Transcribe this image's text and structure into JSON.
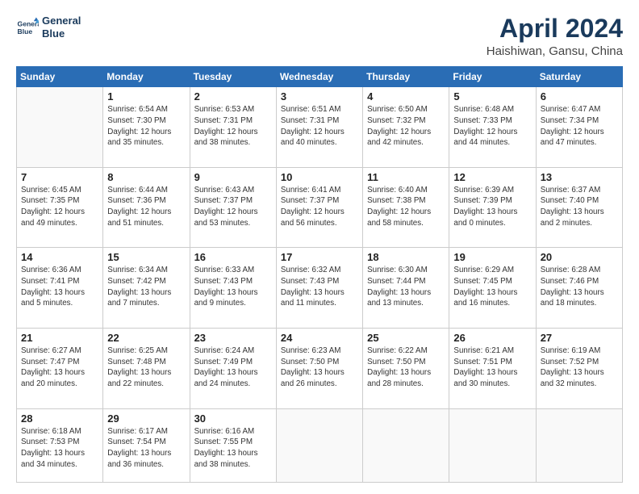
{
  "header": {
    "logo_line1": "General",
    "logo_line2": "Blue",
    "title": "April 2024",
    "subtitle": "Haishiwan, Gansu, China"
  },
  "weekdays": [
    "Sunday",
    "Monday",
    "Tuesday",
    "Wednesday",
    "Thursday",
    "Friday",
    "Saturday"
  ],
  "weeks": [
    [
      {
        "day": "",
        "info": ""
      },
      {
        "day": "1",
        "info": "Sunrise: 6:54 AM\nSunset: 7:30 PM\nDaylight: 12 hours\nand 35 minutes."
      },
      {
        "day": "2",
        "info": "Sunrise: 6:53 AM\nSunset: 7:31 PM\nDaylight: 12 hours\nand 38 minutes."
      },
      {
        "day": "3",
        "info": "Sunrise: 6:51 AM\nSunset: 7:31 PM\nDaylight: 12 hours\nand 40 minutes."
      },
      {
        "day": "4",
        "info": "Sunrise: 6:50 AM\nSunset: 7:32 PM\nDaylight: 12 hours\nand 42 minutes."
      },
      {
        "day": "5",
        "info": "Sunrise: 6:48 AM\nSunset: 7:33 PM\nDaylight: 12 hours\nand 44 minutes."
      },
      {
        "day": "6",
        "info": "Sunrise: 6:47 AM\nSunset: 7:34 PM\nDaylight: 12 hours\nand 47 minutes."
      }
    ],
    [
      {
        "day": "7",
        "info": "Sunrise: 6:45 AM\nSunset: 7:35 PM\nDaylight: 12 hours\nand 49 minutes."
      },
      {
        "day": "8",
        "info": "Sunrise: 6:44 AM\nSunset: 7:36 PM\nDaylight: 12 hours\nand 51 minutes."
      },
      {
        "day": "9",
        "info": "Sunrise: 6:43 AM\nSunset: 7:37 PM\nDaylight: 12 hours\nand 53 minutes."
      },
      {
        "day": "10",
        "info": "Sunrise: 6:41 AM\nSunset: 7:37 PM\nDaylight: 12 hours\nand 56 minutes."
      },
      {
        "day": "11",
        "info": "Sunrise: 6:40 AM\nSunset: 7:38 PM\nDaylight: 12 hours\nand 58 minutes."
      },
      {
        "day": "12",
        "info": "Sunrise: 6:39 AM\nSunset: 7:39 PM\nDaylight: 13 hours\nand 0 minutes."
      },
      {
        "day": "13",
        "info": "Sunrise: 6:37 AM\nSunset: 7:40 PM\nDaylight: 13 hours\nand 2 minutes."
      }
    ],
    [
      {
        "day": "14",
        "info": "Sunrise: 6:36 AM\nSunset: 7:41 PM\nDaylight: 13 hours\nand 5 minutes."
      },
      {
        "day": "15",
        "info": "Sunrise: 6:34 AM\nSunset: 7:42 PM\nDaylight: 13 hours\nand 7 minutes."
      },
      {
        "day": "16",
        "info": "Sunrise: 6:33 AM\nSunset: 7:43 PM\nDaylight: 13 hours\nand 9 minutes."
      },
      {
        "day": "17",
        "info": "Sunrise: 6:32 AM\nSunset: 7:43 PM\nDaylight: 13 hours\nand 11 minutes."
      },
      {
        "day": "18",
        "info": "Sunrise: 6:30 AM\nSunset: 7:44 PM\nDaylight: 13 hours\nand 13 minutes."
      },
      {
        "day": "19",
        "info": "Sunrise: 6:29 AM\nSunset: 7:45 PM\nDaylight: 13 hours\nand 16 minutes."
      },
      {
        "day": "20",
        "info": "Sunrise: 6:28 AM\nSunset: 7:46 PM\nDaylight: 13 hours\nand 18 minutes."
      }
    ],
    [
      {
        "day": "21",
        "info": "Sunrise: 6:27 AM\nSunset: 7:47 PM\nDaylight: 13 hours\nand 20 minutes."
      },
      {
        "day": "22",
        "info": "Sunrise: 6:25 AM\nSunset: 7:48 PM\nDaylight: 13 hours\nand 22 minutes."
      },
      {
        "day": "23",
        "info": "Sunrise: 6:24 AM\nSunset: 7:49 PM\nDaylight: 13 hours\nand 24 minutes."
      },
      {
        "day": "24",
        "info": "Sunrise: 6:23 AM\nSunset: 7:50 PM\nDaylight: 13 hours\nand 26 minutes."
      },
      {
        "day": "25",
        "info": "Sunrise: 6:22 AM\nSunset: 7:50 PM\nDaylight: 13 hours\nand 28 minutes."
      },
      {
        "day": "26",
        "info": "Sunrise: 6:21 AM\nSunset: 7:51 PM\nDaylight: 13 hours\nand 30 minutes."
      },
      {
        "day": "27",
        "info": "Sunrise: 6:19 AM\nSunset: 7:52 PM\nDaylight: 13 hours\nand 32 minutes."
      }
    ],
    [
      {
        "day": "28",
        "info": "Sunrise: 6:18 AM\nSunset: 7:53 PM\nDaylight: 13 hours\nand 34 minutes."
      },
      {
        "day": "29",
        "info": "Sunrise: 6:17 AM\nSunset: 7:54 PM\nDaylight: 13 hours\nand 36 minutes."
      },
      {
        "day": "30",
        "info": "Sunrise: 6:16 AM\nSunset: 7:55 PM\nDaylight: 13 hours\nand 38 minutes."
      },
      {
        "day": "",
        "info": ""
      },
      {
        "day": "",
        "info": ""
      },
      {
        "day": "",
        "info": ""
      },
      {
        "day": "",
        "info": ""
      }
    ]
  ]
}
